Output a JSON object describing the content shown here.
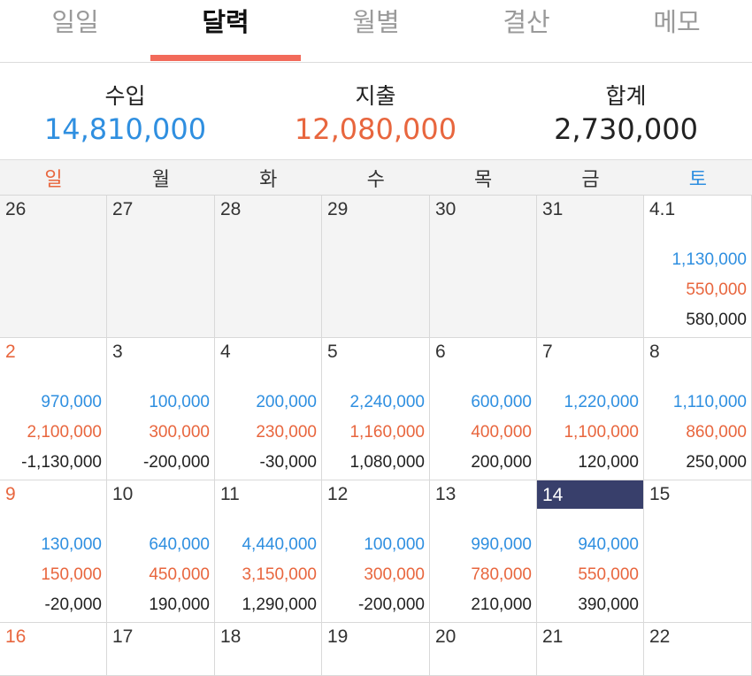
{
  "tabs": [
    {
      "label": "일일",
      "active": false
    },
    {
      "label": "달력",
      "active": true
    },
    {
      "label": "월별",
      "active": false
    },
    {
      "label": "결산",
      "active": false
    },
    {
      "label": "메모",
      "active": false
    }
  ],
  "summary": {
    "income": {
      "label": "수입",
      "value": "14,810,000"
    },
    "expense": {
      "label": "지출",
      "value": "12,080,000"
    },
    "total": {
      "label": "합계",
      "value": "2,730,000"
    }
  },
  "colors": {
    "income": "#2f8fe0",
    "expense": "#e8663e",
    "sunday": "#e8663e",
    "saturday": "#2f8fe0",
    "tab_indicator": "#f26a5a",
    "selected_day": "#383f6b"
  },
  "weekdays": [
    "일",
    "월",
    "화",
    "수",
    "목",
    "금",
    "토"
  ],
  "selected_day": "14",
  "weeks": [
    [
      {
        "day": "26",
        "muted": true
      },
      {
        "day": "27",
        "muted": true
      },
      {
        "day": "28",
        "muted": true
      },
      {
        "day": "29",
        "muted": true
      },
      {
        "day": "30",
        "muted": true
      },
      {
        "day": "31",
        "muted": true
      },
      {
        "day": "4.1",
        "income": "1,130,000",
        "expense": "550,000",
        "total": "580,000"
      }
    ],
    [
      {
        "day": "2",
        "income": "970,000",
        "expense": "2,100,000",
        "total": "-1,130,000"
      },
      {
        "day": "3",
        "income": "100,000",
        "expense": "300,000",
        "total": "-200,000"
      },
      {
        "day": "4",
        "income": "200,000",
        "expense": "230,000",
        "total": "-30,000"
      },
      {
        "day": "5",
        "income": "2,240,000",
        "expense": "1,160,000",
        "total": "1,080,000"
      },
      {
        "day": "6",
        "income": "600,000",
        "expense": "400,000",
        "total": "200,000"
      },
      {
        "day": "7",
        "income": "1,220,000",
        "expense": "1,100,000",
        "total": "120,000"
      },
      {
        "day": "8",
        "income": "1,110,000",
        "expense": "860,000",
        "total": "250,000"
      }
    ],
    [
      {
        "day": "9",
        "income": "130,000",
        "expense": "150,000",
        "total": "-20,000"
      },
      {
        "day": "10",
        "income": "640,000",
        "expense": "450,000",
        "total": "190,000"
      },
      {
        "day": "11",
        "income": "4,440,000",
        "expense": "3,150,000",
        "total": "1,290,000"
      },
      {
        "day": "12",
        "income": "100,000",
        "expense": "300,000",
        "total": "-200,000"
      },
      {
        "day": "13",
        "income": "990,000",
        "expense": "780,000",
        "total": "210,000"
      },
      {
        "day": "14",
        "income": "940,000",
        "expense": "550,000",
        "total": "390,000"
      },
      {
        "day": "15"
      }
    ],
    [
      {
        "day": "16"
      },
      {
        "day": "17"
      },
      {
        "day": "18"
      },
      {
        "day": "19"
      },
      {
        "day": "20"
      },
      {
        "day": "21"
      },
      {
        "day": "22"
      }
    ]
  ]
}
